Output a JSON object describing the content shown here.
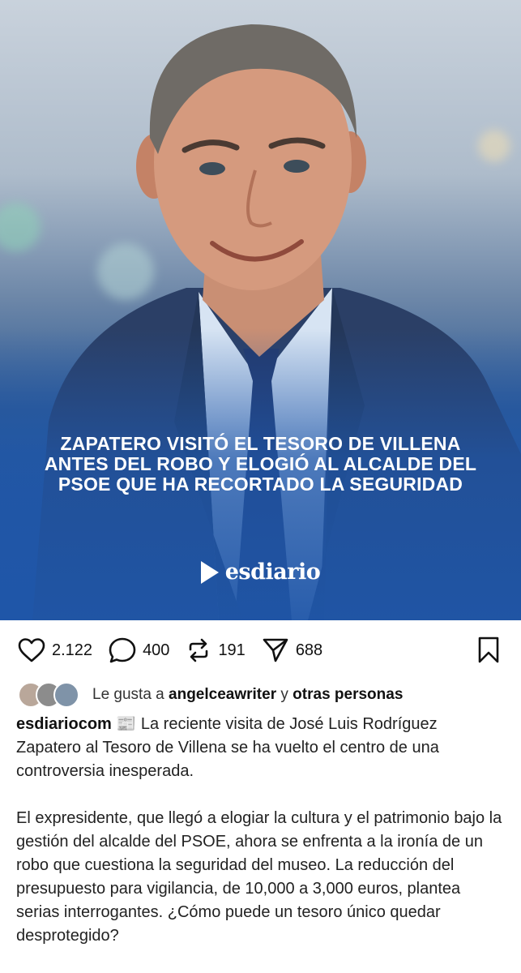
{
  "post": {
    "image": {
      "headline_lines": [
        "ZAPATERO VISITÓ EL TESORO DE VILLENA",
        "ANTES DEL ROBO Y ELOGIÓ AL ALCALDE DEL",
        "PSOE QUE HA RECORTADO LA SEGURIDAD"
      ],
      "brand_name": "esdiario",
      "overlay_color": "#1f56a8"
    },
    "actions": {
      "likes_count": "2.122",
      "comments_count": "400",
      "reposts_count": "191",
      "shares_count": "688"
    },
    "liked_by": {
      "prefix": "Le gusta a",
      "user": "angelceawriter",
      "connector": "y",
      "others": "otras personas"
    },
    "caption": {
      "username": "esdiariocom",
      "emoji": "📰",
      "paragraph_1": "La reciente visita de José Luis Rodríguez Zapatero al Tesoro de Villena se ha vuelto el centro de una controversia inesperada.",
      "paragraph_2": "El expresidente, que llegó a elogiar la cultura y el patrimonio bajo la gestión del alcalde del PSOE, ahora se enfrenta a la ironía de un robo que cuestiona la seguridad del museo. La reducción del presupuesto para vigilancia, de 10,000 a 3,000 euros, plantea serias interrogantes. ¿Cómo puede un tesoro único quedar desprotegido?"
    }
  }
}
